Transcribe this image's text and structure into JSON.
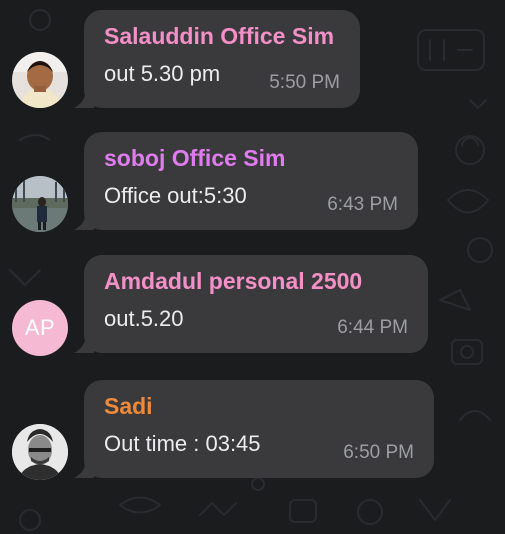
{
  "messages": [
    {
      "sender": "Salauddin Office Sim",
      "sender_color": "#f48fc7",
      "text": "out 5.30 pm",
      "time": "5:50 PM",
      "avatar": {
        "type": "photo",
        "icon": "user-photo-avatar"
      }
    },
    {
      "sender": "soboj Office Sim",
      "sender_color": "#e07cf0",
      "text": "Office out:5:30",
      "time": "6:43 PM",
      "avatar": {
        "type": "photo",
        "icon": "user-photo-avatar"
      }
    },
    {
      "sender": "Amdadul personal 2500",
      "sender_color": "#f48fc7",
      "text": "out.5.20",
      "time": "6:44 PM",
      "avatar": {
        "type": "initials",
        "initials": "AP",
        "bg": "#f5b9d3"
      }
    },
    {
      "sender": "Sadi",
      "sender_color": "#ee8a3c",
      "text": "Out time : 03:45",
      "time": "6:50 PM",
      "avatar": {
        "type": "photo",
        "icon": "user-photo-avatar"
      }
    }
  ],
  "colors": {
    "background": "#1b1c1e",
    "bubble": "#3a3a3d",
    "message_text": "#ececee",
    "timestamp": "#9d9ea2"
  }
}
